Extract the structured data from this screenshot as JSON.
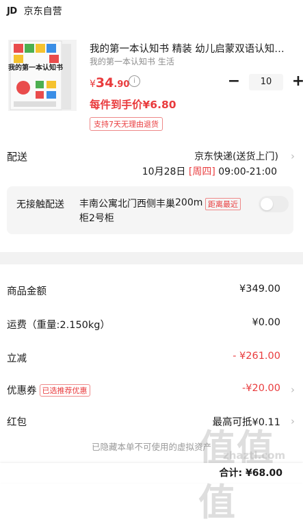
{
  "store": {
    "logo": "JD",
    "name": "京东自营"
  },
  "product": {
    "title": "我的第一本认知书 精装 幼儿启蒙双语认知启蒙绘本",
    "subtitle": "我的第一本认知书 生活",
    "cover_text": "我的第一本认知书",
    "price_symbol": "¥",
    "price_int": "34",
    "price_dec": ".90",
    "hand_price": "每件到手价¥6.80",
    "return_policy": "支持7天无理由退货",
    "quantity": "10",
    "minus": "−",
    "plus": "+"
  },
  "delivery": {
    "label": "配送",
    "method": "京东快递(送货上门)",
    "date": "10月28日",
    "weekday": "[周四]",
    "time": "09:00-21:00"
  },
  "contactless": {
    "label": "无接触配送",
    "address": "丰南公寓北门西侧丰巢柜2号柜",
    "distance": "200m",
    "badge": "距离最近",
    "enabled": false
  },
  "summary": {
    "goods_label": "商品金额",
    "goods_value": "¥349.00",
    "freight_label": "运费（重量:2.150kg）",
    "freight_value": "¥0.00",
    "discount_label": "立减",
    "discount_value": "- ¥261.00",
    "coupon_label": "优惠券",
    "coupon_tag": "已选推荐优惠",
    "coupon_value": "-¥20.00",
    "redpacket_label": "红包",
    "redpacket_value": "最高可抵¥0.11",
    "hidden_note": "已隐藏本单不可使用的虚拟资产",
    "total": "合计: ¥68.00"
  },
  "watermark": {
    "mark": "值值值",
    "url": "zhaztl.com"
  },
  "colors": {
    "accent": "#e93b3d",
    "separator": "#f2f2f2"
  }
}
